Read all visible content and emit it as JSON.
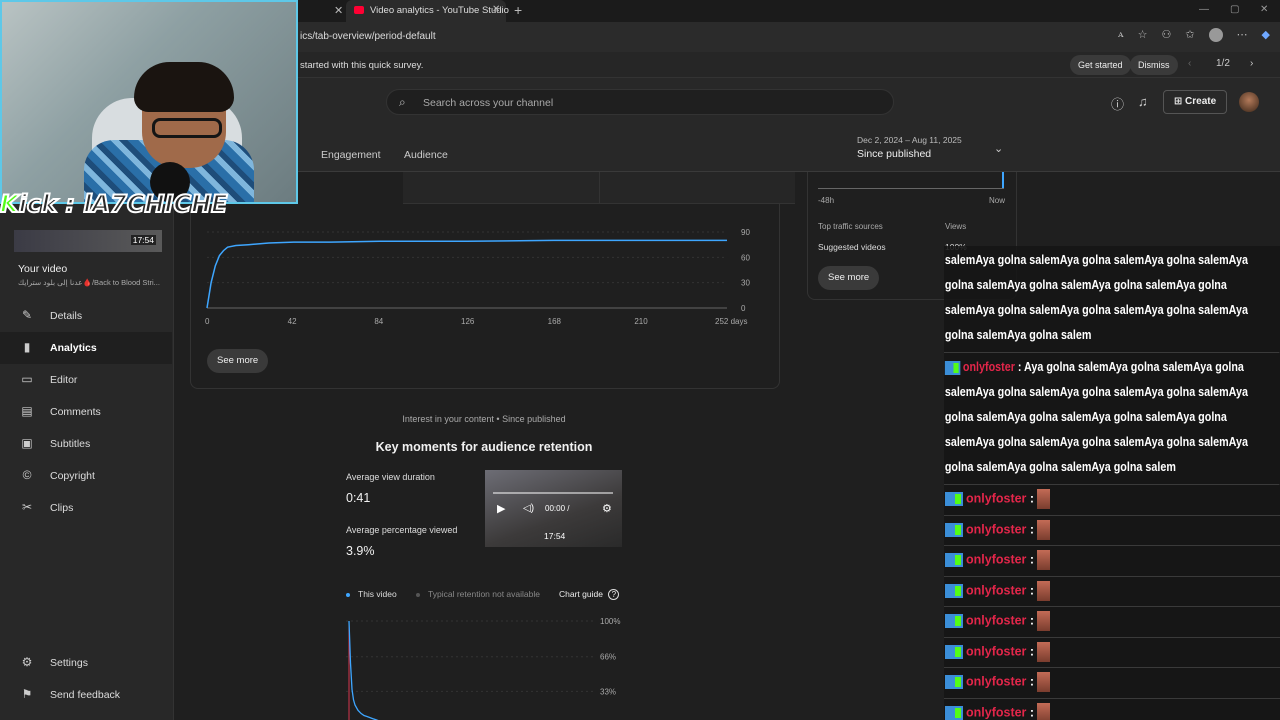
{
  "browser": {
    "tab_title": "Video analytics - YouTube Studio",
    "close_glyph": "✕",
    "newtab_glyph": "+",
    "url": "ics/tab-overview/period-default",
    "win_controls": [
      "—",
      "▢",
      "✕"
    ]
  },
  "survey": {
    "text": "started with this quick survey.",
    "get_started": "Get started",
    "dismiss": "Dismiss",
    "page": "1/2"
  },
  "header": {
    "search_placeholder": "Search across your channel",
    "create_label": "Create"
  },
  "tabs": [
    "Engagement",
    "Audience"
  ],
  "date": {
    "range": "Dec 2, 2024 – Aug 11, 2025",
    "label": "Since published"
  },
  "sidebar": {
    "thumb_duration": "17:54",
    "your_video": "Your video",
    "video_name": "عدنا إلى بلود سترايك🩸/Back to Blood Stri...",
    "items": [
      {
        "label": "Details",
        "icon": "pencil-icon",
        "glyph": "✎"
      },
      {
        "label": "Analytics",
        "icon": "analytics-icon",
        "glyph": "▮"
      },
      {
        "label": "Editor",
        "icon": "editor-icon",
        "glyph": "▭"
      },
      {
        "label": "Comments",
        "icon": "comments-icon",
        "glyph": "▤"
      },
      {
        "label": "Subtitles",
        "icon": "subtitles-icon",
        "glyph": "▣"
      },
      {
        "label": "Copyright",
        "icon": "copyright-icon",
        "glyph": "©"
      },
      {
        "label": "Clips",
        "icon": "scissors-icon",
        "glyph": "✂"
      }
    ],
    "settings": "Settings",
    "send_feedback": "Send feedback"
  },
  "main": {
    "see_more": "See more",
    "interest": "Interest in your content • Since published",
    "km_title": "Key moments for audience retention",
    "avg_view_duration_label": "Average view duration",
    "avg_view_duration": "0:41",
    "avg_pct_label": "Average percentage viewed",
    "avg_pct": "3.9%",
    "thumb_time": "00:00 /",
    "thumb_duration": "17:54",
    "legend_this": "This video",
    "legend_typical": "Typical retention not available",
    "chart_guide": "Chart guide",
    "accent": "#3ea6ff"
  },
  "right_card": {
    "t0": "-48h",
    "t1": "Now",
    "top_sources": "Top traffic sources",
    "views": "Views",
    "suggested": "Suggested videos",
    "suggested_val": "100%",
    "see_more": "See more"
  },
  "webcam": {
    "kick_k": "K",
    "kick_rest": "ick : lA7CHICHE"
  },
  "chat": {
    "msg1": "salemAya golna salemAya golna salemAya golna salemAya golna salemAya golna salemAya golna salemAya golna salemAya golna salemAya golna salemAya golna salemAya golna salemAya golna salem",
    "user": "onlyfoster",
    "msg2": "Aya golna salemAya golna salemAya golna salemAya golna salemAya golna salemAya golna salemAya golna salemAya golna salemAya golna salemAya golna salemAya golna salemAya golna salemAya golna salemAya golna salemAya golna salemAya golna salem",
    "emote_rows": 8
  },
  "chart_data": [
    {
      "type": "line",
      "x": [
        0,
        2,
        4,
        6,
        8,
        10,
        14,
        20,
        30,
        42,
        60,
        84,
        126,
        168,
        210,
        252
      ],
      "values": [
        0,
        30,
        50,
        62,
        68,
        72,
        74,
        75,
        77,
        78,
        78,
        79,
        79,
        80,
        80,
        80
      ],
      "xticks": [
        "0",
        "42",
        "84",
        "126",
        "168",
        "210",
        "252 days"
      ],
      "yticks": [
        "0",
        "30",
        "60",
        "90"
      ],
      "xlim": [
        0,
        252
      ],
      "ylim": [
        0,
        90
      ],
      "color": "#3ea6ff"
    },
    {
      "type": "line",
      "x": [
        0,
        1,
        2,
        3,
        4,
        6,
        8,
        10,
        12,
        14,
        16,
        18,
        20,
        22,
        24,
        26,
        28,
        30,
        32
      ],
      "values": [
        100,
        60,
        35,
        25,
        20,
        15,
        12,
        10,
        9,
        8,
        7,
        6,
        5,
        4,
        3,
        2,
        2,
        1,
        1
      ],
      "yticks": [
        "100%",
        "66%",
        "33%"
      ],
      "xlim": [
        0,
        32
      ],
      "ylim": [
        0,
        100
      ],
      "color": "#3ea6ff"
    }
  ]
}
